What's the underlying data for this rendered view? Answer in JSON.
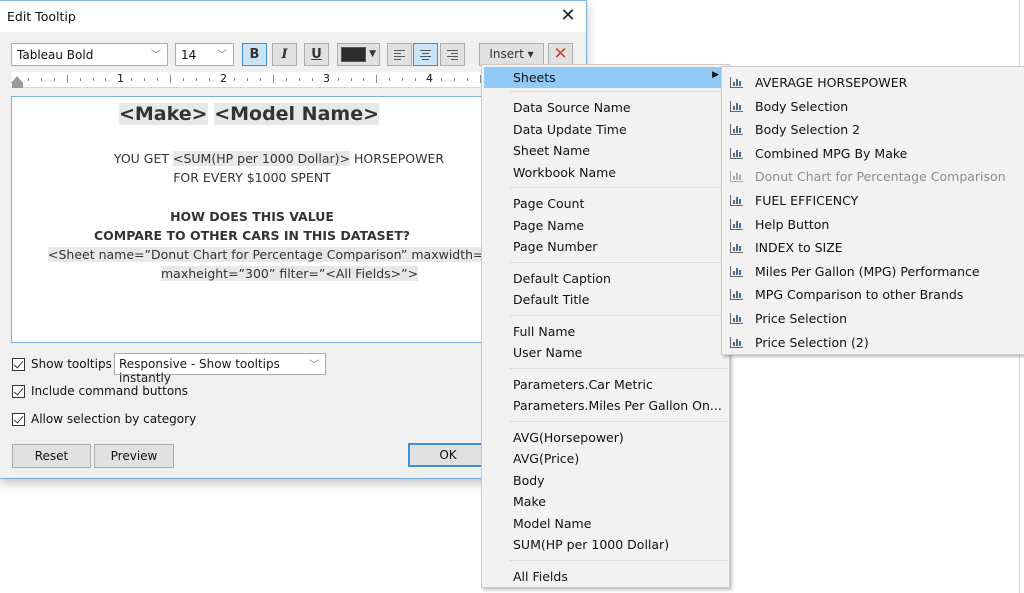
{
  "dialog": {
    "title": "Edit Tooltip",
    "close_glyph": "✕",
    "toolbar": {
      "font_name": "Tableau Bold",
      "font_size": "14",
      "bold_label": "B",
      "italic_label": "I",
      "underline_label": "U",
      "text_color": "#2b2b2b",
      "insert_label": "Insert ▾",
      "clear_glyph": "✕",
      "clear_color": "#d9442b"
    },
    "ruler": {
      "numbers": [
        "1",
        "2",
        "3",
        "4"
      ]
    },
    "editor": {
      "title_parts": [
        "<Make>",
        "<Model Name>"
      ],
      "line1_pre": "YOU GET ",
      "line1_field": "<SUM(HP per 1000 Dollar)>",
      "line1_post": " HORSEPOWER",
      "line2": "FOR EVERY $1000 SPENT",
      "line3": "HOW DOES THIS VALUE",
      "line4": "COMPARE TO OTHER CARS IN THIS DATASET?",
      "line5": "<Sheet name=”Donut Chart for Percentage Comparison” maxwidth=”300”",
      "line6": "maxheight=”300” filter=”<All Fields>”>"
    },
    "options": {
      "show_tooltips": {
        "label": "Show tooltips",
        "checked": true
      },
      "tooltip_mode": "Responsive - Show tooltips instantly",
      "include_command_buttons": {
        "label": "Include command buttons",
        "checked": true
      },
      "allow_selection": {
        "label": "Allow selection by category",
        "checked": true
      }
    },
    "buttons": {
      "reset": "Reset",
      "preview": "Preview",
      "ok": "OK"
    }
  },
  "insert_menu": {
    "sheets_label": "Sheets",
    "groups": [
      [
        "Data Source Name",
        "Data Update Time",
        "Sheet Name",
        "Workbook Name"
      ],
      [
        "Page Count",
        "Page Name",
        "Page Number"
      ],
      [
        "Default Caption",
        "Default Title"
      ],
      [
        "Full Name",
        "User Name"
      ],
      [
        "Parameters.Car Metric",
        "Parameters.Miles Per Gallon On..."
      ],
      [
        "AVG(Horsepower)",
        "AVG(Price)",
        "Body",
        "Make",
        "Model Name",
        "SUM(HP per 1000 Dollar)"
      ],
      [
        "All Fields"
      ]
    ]
  },
  "sheets_submenu": [
    {
      "label": "AVERAGE HORSEPOWER",
      "disabled": false
    },
    {
      "label": "Body Selection",
      "disabled": false
    },
    {
      "label": "Body Selection 2",
      "disabled": false
    },
    {
      "label": "Combined MPG By Make",
      "disabled": false
    },
    {
      "label": "Donut Chart for Percentage Comparison",
      "disabled": true
    },
    {
      "label": "FUEL EFFICENCY",
      "disabled": false
    },
    {
      "label": "Help Button",
      "disabled": false
    },
    {
      "label": "INDEX to SIZE",
      "disabled": false
    },
    {
      "label": "Miles Per Gallon (MPG) Performance",
      "disabled": false
    },
    {
      "label": "MPG Comparison to other Brands",
      "disabled": false
    },
    {
      "label": "Price Selection",
      "disabled": false
    },
    {
      "label": "Price Selection (2)",
      "disabled": false
    }
  ]
}
